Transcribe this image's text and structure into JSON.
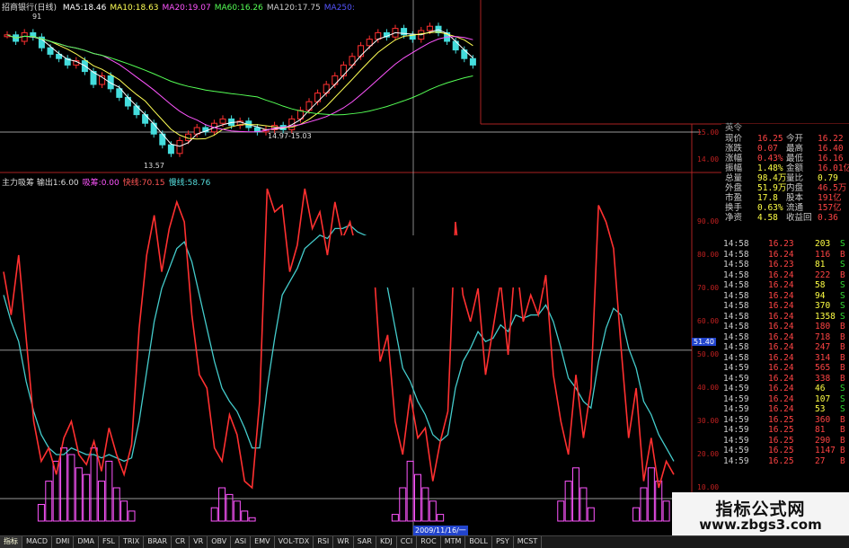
{
  "title": "招商银行(日线)",
  "ma_legend": [
    {
      "label": "MA5:18.46",
      "color": "#ffffff"
    },
    {
      "label": "MA10:18.63",
      "color": "#ffff55"
    },
    {
      "label": "MA20:19.07",
      "color": "#ff55ff"
    },
    {
      "label": "MA60:16.26",
      "color": "#55ff55"
    },
    {
      "label": "MA120:17.75",
      "color": "#cccccc"
    },
    {
      "label": "MA250:",
      "color": "#5555ff"
    }
  ],
  "price_annotations": {
    "high": "91",
    "low": "13.57",
    "range": "14.97-15.03"
  },
  "indicator_legend": [
    {
      "label": "主力吸筹 输出1:6.00",
      "color": "#dddddd"
    },
    {
      "label": "吸筹:0.00",
      "color": "#ff55ff"
    },
    {
      "label": "快线:70.15",
      "color": "#ff5555"
    },
    {
      "label": "慢线:58.76",
      "color": "#55dddd"
    }
  ],
  "axis_ticks": {
    "price": [
      "15.00",
      "14.00"
    ],
    "indicator": [
      "90.00",
      "80.00",
      "70.00",
      "60.00",
      "50.00",
      "40.00",
      "30.00",
      "20.00",
      "10.00"
    ],
    "cursor_value": "51.40"
  },
  "date_label": "2009/11/16/一",
  "quote": {
    "partial_top": "英令",
    "rows": [
      {
        "l1": "现价",
        "v1": "16.25",
        "l2": "今开",
        "v2": "16.22"
      },
      {
        "l1": "涨跌",
        "v1": "0.07",
        "l2": "最高",
        "v2": "16.40"
      },
      {
        "l1": "涨幅",
        "v1": "0.43%",
        "l2": "最低",
        "v2": "16.16"
      },
      {
        "l1": "振幅",
        "v1": "1.48%",
        "l2": "金额",
        "v2": "16.01亿"
      },
      {
        "l1": "总量",
        "v1": "98.4万",
        "l2": "量比",
        "v2": "0.79"
      },
      {
        "l1": "外盘",
        "v1": "51.9万",
        "l2": "内盘",
        "v2": "46.5万"
      },
      {
        "l1": "市盈",
        "v1": "17.8",
        "l2": "股本",
        "v2": "191亿"
      },
      {
        "l1": "换手",
        "v1": "0.63%",
        "l2": "流通",
        "v2": "157亿"
      },
      {
        "l1": "净资",
        "v1": "4.58",
        "l2": "收益回",
        "v2": "0.36"
      }
    ],
    "colors": {
      "up": "#ff4444",
      "down": "#33dd33",
      "label": "#cccccc",
      "value": "#ffff44"
    }
  },
  "ticks": [
    {
      "time": "14:58",
      "price": "16.23",
      "vol": "203",
      "side": "S"
    },
    {
      "time": "14:58",
      "price": "16.24",
      "vol": "116",
      "side": "B"
    },
    {
      "time": "14:58",
      "price": "16.23",
      "vol": "81",
      "side": "S"
    },
    {
      "time": "14:58",
      "price": "16.24",
      "vol": "222",
      "side": "B"
    },
    {
      "time": "14:58",
      "price": "16.24",
      "vol": "58",
      "side": "S"
    },
    {
      "time": "14:58",
      "price": "16.24",
      "vol": "94",
      "side": "S"
    },
    {
      "time": "14:58",
      "price": "16.24",
      "vol": "370",
      "side": "S"
    },
    {
      "time": "14:58",
      "price": "16.24",
      "vol": "1358",
      "side": "S"
    },
    {
      "time": "14:58",
      "price": "16.24",
      "vol": "180",
      "side": "B"
    },
    {
      "time": "14:58",
      "price": "16.24",
      "vol": "718",
      "side": "B"
    },
    {
      "time": "14:58",
      "price": "16.24",
      "vol": "247",
      "side": "B"
    },
    {
      "time": "14:58",
      "price": "16.24",
      "vol": "314",
      "side": "B"
    },
    {
      "time": "14:59",
      "price": "16.24",
      "vol": "565",
      "side": "B"
    },
    {
      "time": "14:59",
      "price": "16.24",
      "vol": "338",
      "side": "B"
    },
    {
      "time": "14:59",
      "price": "16.24",
      "vol": "46",
      "side": "S"
    },
    {
      "time": "14:59",
      "price": "16.24",
      "vol": "107",
      "side": "S"
    },
    {
      "time": "14:59",
      "price": "16.24",
      "vol": "53",
      "side": "S"
    },
    {
      "time": "14:59",
      "price": "16.25",
      "vol": "360",
      "side": "B"
    },
    {
      "time": "14:59",
      "price": "16.25",
      "vol": "81",
      "side": "B"
    },
    {
      "time": "14:59",
      "price": "16.25",
      "vol": "290",
      "side": "B"
    },
    {
      "time": "14:59",
      "price": "16.25",
      "vol": "1147",
      "side": "B"
    },
    {
      "time": "14:59",
      "price": "16.25",
      "vol": "27",
      "side": "B"
    }
  ],
  "tabs": [
    "指标",
    "MACD",
    "DMI",
    "DMA",
    "FSL",
    "TRIX",
    "BRAR",
    "CR",
    "VR",
    "OBV",
    "ASI",
    "EMV",
    "VOL-TDX",
    "RSI",
    "WR",
    "SAR",
    "KDJ",
    "CCI",
    "ROC",
    "MTM",
    "BOLL",
    "PSY",
    "MCST"
  ],
  "active_tab": "指标",
  "watermark": {
    "line1": "指标公式网",
    "line2": "www.zbgs3.com"
  },
  "chart_data": {
    "type": "line",
    "x_index": [
      0,
      1,
      2,
      3,
      4,
      5,
      6,
      7,
      8,
      9,
      10,
      11,
      12,
      13,
      14,
      15,
      16,
      17,
      18,
      19,
      20,
      21,
      22,
      23,
      24,
      25,
      26,
      27,
      28,
      29,
      30,
      31,
      32,
      33,
      34,
      35,
      36,
      37,
      38,
      39,
      40,
      41,
      42,
      43,
      44,
      45,
      46,
      47,
      48,
      49,
      50,
      51,
      52,
      53,
      54,
      55,
      56,
      57,
      58,
      59,
      60,
      61,
      62,
      63,
      64,
      65,
      66,
      67,
      68,
      69,
      70,
      71,
      72,
      73,
      74,
      75,
      76,
      77,
      78,
      79,
      80,
      81,
      82,
      83,
      84,
      85,
      86,
      87,
      88,
      89
    ],
    "ylim": [
      0,
      100
    ],
    "series": [
      {
        "name": "快线",
        "color": "#ff3030",
        "values": [
          75,
          62,
          80,
          55,
          30,
          18,
          22,
          14,
          25,
          30,
          20,
          17,
          24,
          15,
          28,
          20,
          14,
          23,
          58,
          80,
          92,
          75,
          88,
          96,
          90,
          62,
          44,
          40,
          22,
          18,
          32,
          26,
          12,
          10,
          36,
          100,
          93,
          95,
          75,
          83,
          100,
          88,
          93,
          80,
          96,
          85,
          90,
          80,
          85,
          82,
          48,
          56,
          30,
          20,
          38,
          25,
          28,
          12,
          24,
          33,
          90,
          68,
          60,
          70,
          44,
          58,
          72,
          50,
          80,
          60,
          68,
          62,
          74,
          44,
          30,
          20,
          44,
          25,
          40,
          95,
          90,
          82,
          52,
          25,
          40,
          12,
          25,
          10,
          18,
          14
        ]
      },
      {
        "name": "慢线",
        "color": "#44cccc",
        "values": [
          68,
          60,
          54,
          42,
          33,
          26,
          22,
          20,
          20,
          22,
          21,
          20,
          20,
          19,
          20,
          19,
          18,
          19,
          30,
          45,
          60,
          70,
          76,
          82,
          84,
          78,
          68,
          58,
          48,
          40,
          36,
          33,
          28,
          22,
          22,
          40,
          55,
          68,
          72,
          76,
          82,
          84,
          86,
          85,
          88,
          88,
          89,
          87,
          86,
          85,
          78,
          70,
          58,
          46,
          42,
          36,
          32,
          26,
          24,
          26,
          40,
          48,
          52,
          57,
          54,
          55,
          59,
          57,
          62,
          61,
          62,
          62,
          65,
          60,
          52,
          43,
          40,
          36,
          34,
          48,
          58,
          64,
          62,
          52,
          46,
          36,
          32,
          26,
          22,
          18
        ]
      },
      {
        "name": "吸筹",
        "color": "#ff55ff",
        "values": [
          0,
          0,
          0,
          0,
          0,
          5,
          12,
          18,
          22,
          20,
          16,
          14,
          22,
          12,
          18,
          10,
          6,
          3,
          0,
          0,
          0,
          0,
          0,
          0,
          0,
          0,
          0,
          0,
          4,
          10,
          8,
          6,
          3,
          1,
          0,
          0,
          0,
          0,
          0,
          0,
          0,
          0,
          0,
          0,
          0,
          0,
          0,
          0,
          0,
          0,
          0,
          0,
          2,
          10,
          18,
          14,
          10,
          6,
          2,
          0,
          0,
          0,
          0,
          0,
          0,
          0,
          0,
          0,
          0,
          0,
          0,
          0,
          0,
          0,
          6,
          12,
          16,
          10,
          4,
          0,
          0,
          0,
          0,
          0,
          4,
          10,
          16,
          12,
          6,
          0
        ]
      }
    ]
  }
}
